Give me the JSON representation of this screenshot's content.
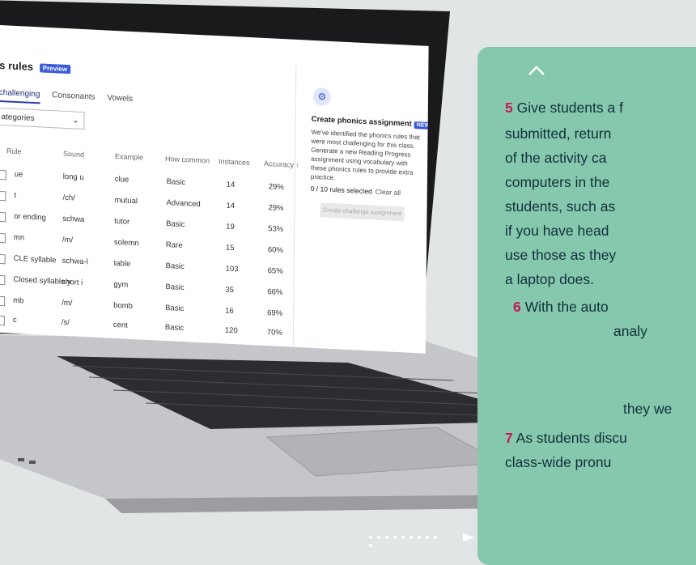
{
  "screen": {
    "title": "s rules",
    "preview_badge": "Preview",
    "tabs": [
      {
        "label": "challenging",
        "active": true
      },
      {
        "label": "Consonants",
        "active": false
      },
      {
        "label": "Vowels",
        "active": false
      }
    ],
    "filter_value": "ategories",
    "table": {
      "headers": [
        "Rule",
        "Sound",
        "Example",
        "How common",
        "Instances",
        "Accuracy ↑"
      ],
      "rows": [
        {
          "rule": "ue",
          "sound": "long u",
          "example": "clue",
          "common": "Basic",
          "instances": "14",
          "accuracy": "29%"
        },
        {
          "rule": "t",
          "sound": "/ch/",
          "example": "mutual",
          "common": "Advanced",
          "instances": "14",
          "accuracy": "29%"
        },
        {
          "rule": "or ending",
          "sound": "schwa",
          "example": "tutor",
          "common": "Basic",
          "instances": "19",
          "accuracy": "53%"
        },
        {
          "rule": "mn",
          "sound": "/m/",
          "example": "solemn",
          "common": "Rare",
          "instances": "15",
          "accuracy": "60%"
        },
        {
          "rule": "CLE syllable",
          "sound": "schwa-l",
          "example": "table",
          "common": "Basic",
          "instances": "103",
          "accuracy": "65%"
        },
        {
          "rule": "Closed syllable y",
          "sound": "short i",
          "example": "gym",
          "common": "Basic",
          "instances": "35",
          "accuracy": "66%"
        },
        {
          "rule": "mb",
          "sound": "/m/",
          "example": "bomb",
          "common": "Basic",
          "instances": "16",
          "accuracy": "69%"
        },
        {
          "rule": "c",
          "sound": "/s/",
          "example": "cent",
          "common": "Basic",
          "instances": "120",
          "accuracy": "70%"
        }
      ]
    },
    "side": {
      "title": "Create phonics assignment",
      "new_badge": "NEW",
      "description": "We've identified the phonics rules that were most challenging for this class. Generate a new Reading Progress assignment using vocabulary with these phonics rules to provide extra practice.",
      "count": "0 / 10 rules selected",
      "clear": "Clear all",
      "button": "Create challenge assignment"
    }
  },
  "panel": {
    "lines": [
      {
        "num": "5",
        "text": "Give students a f"
      },
      {
        "num": "",
        "text": "submitted, return"
      },
      {
        "num": "",
        "text": "of the activity ca"
      },
      {
        "num": "",
        "text": "computers in the"
      },
      {
        "num": "",
        "text": "students, such as"
      },
      {
        "num": "",
        "text": "if you have head"
      },
      {
        "num": "",
        "text": "use those as they"
      },
      {
        "num": "",
        "text": "a laptop does."
      },
      {
        "num": "6",
        "text": "With the auto"
      },
      {
        "num": "",
        "text": "analy"
      },
      {
        "num": "",
        "text": "they we"
      },
      {
        "num": "7",
        "text": "As students discu"
      },
      {
        "num": "",
        "text": "class-wide pronu"
      }
    ]
  },
  "colors": {
    "panel": "#86c8ad",
    "accent_number": "#c2185b",
    "badge": "#3b5bdb"
  }
}
